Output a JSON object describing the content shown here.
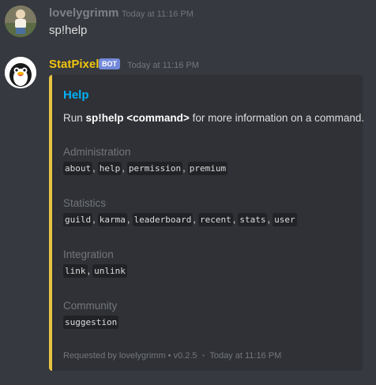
{
  "messages": [
    {
      "username": "lovelygrimm",
      "username_color": "#7e8086",
      "timestamp": "Today at 11:16 PM",
      "content": "sp!help"
    },
    {
      "username": "StatPixel",
      "username_color": "#f1c40f",
      "badge": "BOT",
      "timestamp": "Today at 11:16 PM",
      "embed": {
        "accent_color": "#e8c542",
        "title": "Help",
        "description_pre": "Run ",
        "description_bold": "sp!help <command>",
        "description_post": " for more information on a command.",
        "fields": [
          {
            "name": "Administration",
            "values": [
              "about",
              "help",
              "permission",
              "premium"
            ]
          },
          {
            "name": "Statistics",
            "values": [
              "guild",
              "karma",
              "leaderboard",
              "recent",
              "stats",
              "user"
            ]
          },
          {
            "name": "Integration",
            "values": [
              "link",
              "unlink"
            ]
          },
          {
            "name": "Community",
            "values": [
              "suggestion"
            ]
          }
        ],
        "footer_text": "Requested by lovelygrimm • v0.2.5",
        "footer_separator": "•",
        "footer_time": "Today at 11:16 PM"
      }
    }
  ]
}
